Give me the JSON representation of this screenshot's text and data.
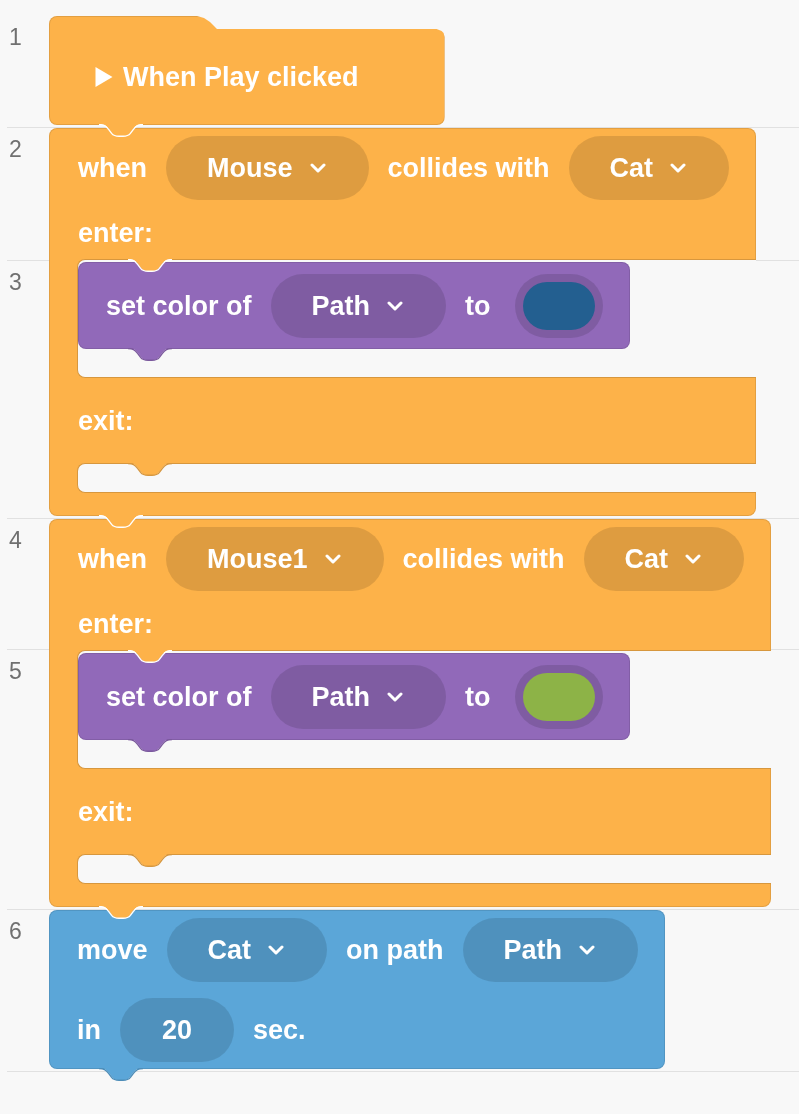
{
  "line_numbers": [
    "1",
    "2",
    "3",
    "4",
    "5",
    "6"
  ],
  "blocks": [
    {
      "kind": "hat",
      "color": "#fdb249",
      "label": "When Play clicked"
    },
    {
      "kind": "c",
      "color": "#fdb249",
      "rows": [
        [
          {
            "kind": "text",
            "text": "when"
          },
          {
            "kind": "dropdown",
            "text": "Mouse"
          },
          {
            "kind": "text",
            "text": "collides with"
          },
          {
            "kind": "dropdown",
            "text": "Cat"
          }
        ],
        [
          {
            "kind": "text",
            "text": "enter:"
          }
        ]
      ],
      "body": [
        {
          "kind": "statement",
          "color": "#9169b9",
          "rows": [
            [
              {
                "kind": "text",
                "text": "set color of"
              },
              {
                "kind": "dropdown",
                "text": "Path"
              },
              {
                "kind": "text",
                "text": "to"
              },
              {
                "kind": "swatch",
                "color": "#235f90"
              }
            ]
          ]
        }
      ],
      "middle_rows": [
        [
          {
            "kind": "text",
            "text": "exit:"
          }
        ]
      ]
    },
    {
      "kind": "c",
      "color": "#fdb249",
      "rows": [
        [
          {
            "kind": "text",
            "text": "when"
          },
          {
            "kind": "dropdown",
            "text": "Mouse1"
          },
          {
            "kind": "text",
            "text": "collides with"
          },
          {
            "kind": "dropdown",
            "text": "Cat"
          }
        ],
        [
          {
            "kind": "text",
            "text": "enter:"
          }
        ]
      ],
      "body": [
        {
          "kind": "statement",
          "color": "#9169b9",
          "rows": [
            [
              {
                "kind": "text",
                "text": "set color of"
              },
              {
                "kind": "dropdown",
                "text": "Path"
              },
              {
                "kind": "text",
                "text": "to"
              },
              {
                "kind": "swatch",
                "color": "#8db347"
              }
            ]
          ]
        }
      ],
      "middle_rows": [
        [
          {
            "kind": "text",
            "text": "exit:"
          }
        ]
      ]
    },
    {
      "kind": "statement",
      "color": "#5ba6d8",
      "rows": [
        [
          {
            "kind": "text",
            "text": "move"
          },
          {
            "kind": "dropdown",
            "text": "Cat"
          },
          {
            "kind": "text",
            "text": "on path"
          },
          {
            "kind": "dropdown",
            "text": "Path"
          }
        ],
        [
          {
            "kind": "text",
            "text": "in"
          },
          {
            "kind": "number",
            "text": "20"
          },
          {
            "kind": "text",
            "text": "sec."
          }
        ]
      ]
    }
  ]
}
